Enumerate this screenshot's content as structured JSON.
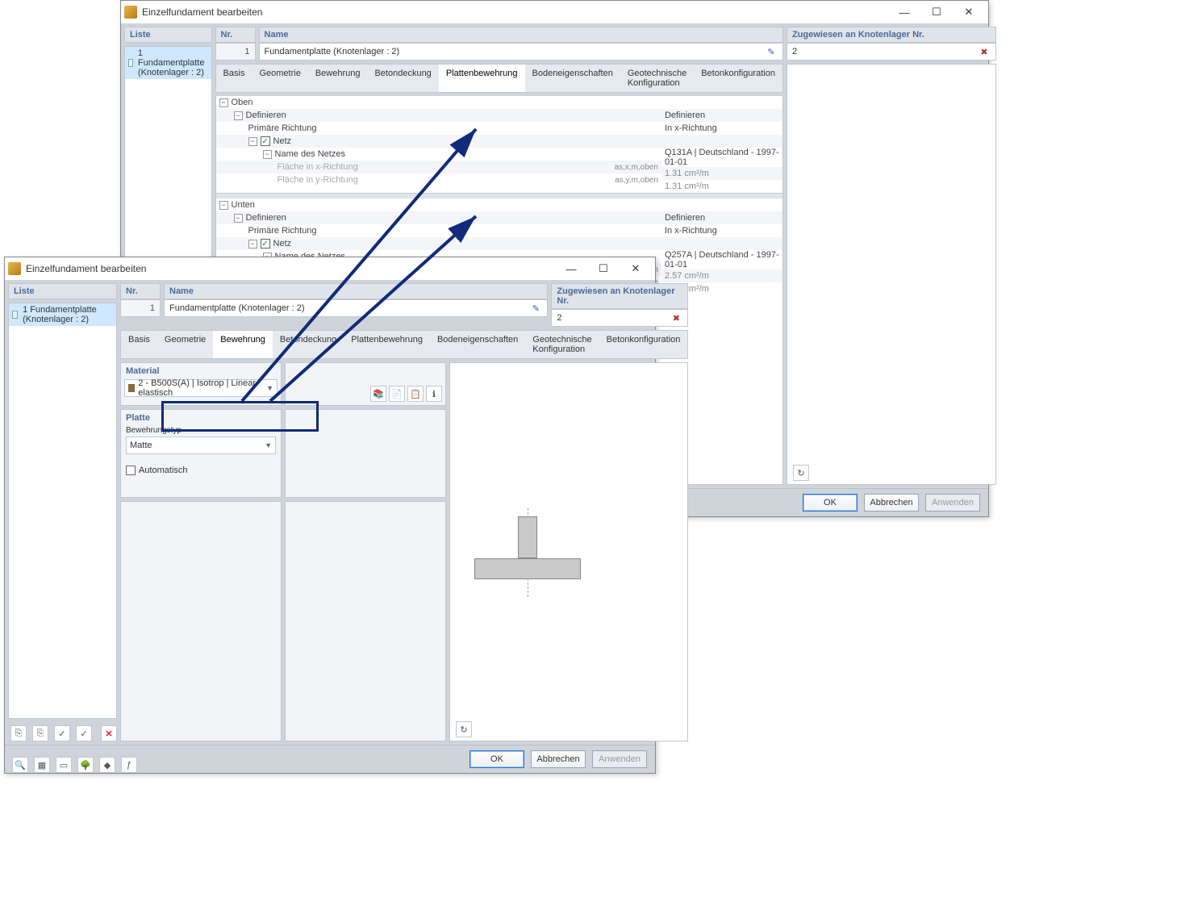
{
  "windowTitle": "Einzelfundament bearbeiten",
  "list": {
    "header": "Liste",
    "item1": "1 Fundamentplatte (Knotenlager : 2)"
  },
  "nrHeader": "Nr.",
  "nrValue": "1",
  "nameHeader": "Name",
  "nameValue": "Fundamentplatte (Knotenlager : 2)",
  "assignedHeader": "Zugewiesen an Knotenlager Nr.",
  "assignedValue": "2",
  "tabs": {
    "t0": "Basis",
    "t1": "Geometrie",
    "t2": "Bewehrung",
    "t3": "Betondeckung",
    "t4": "Plattenbewehrung",
    "t5": "Bodeneigenschaften",
    "t6": "Geotechnische Konfiguration",
    "t7": "Betonkonfiguration"
  },
  "tree": {
    "oben": "Oben",
    "unten": "Unten",
    "definieren": "Definieren",
    "definierenR": "Definieren",
    "primRichtung": "Primäre Richtung",
    "inX": "In x-Richtung",
    "netz": "Netz",
    "nameNetz": "Name des Netzes",
    "net1": "Q131A | Deutschland - 1997-01-01",
    "net2": "Q257A | Deutschland - 1997-01-01",
    "flX": "Fläche in x-Richtung",
    "flY": "Fläche in y-Richtung",
    "asx": "as,x,m,oben",
    "asy": "as,y,m,oben",
    "v131": "1.31",
    "v257": "2.57",
    "unit": "cm²/m"
  },
  "buttons": {
    "ok": "OK",
    "cancel": "Abbrechen",
    "apply": "Anwenden"
  },
  "dlg2": {
    "material": "Material",
    "materialVal": "2 - B500S(A) | Isotrop | Linear elastisch",
    "platte": "Platte",
    "bewTyp": "Bewehrungstyp",
    "matte": "Matte",
    "auto": "Automatisch"
  }
}
